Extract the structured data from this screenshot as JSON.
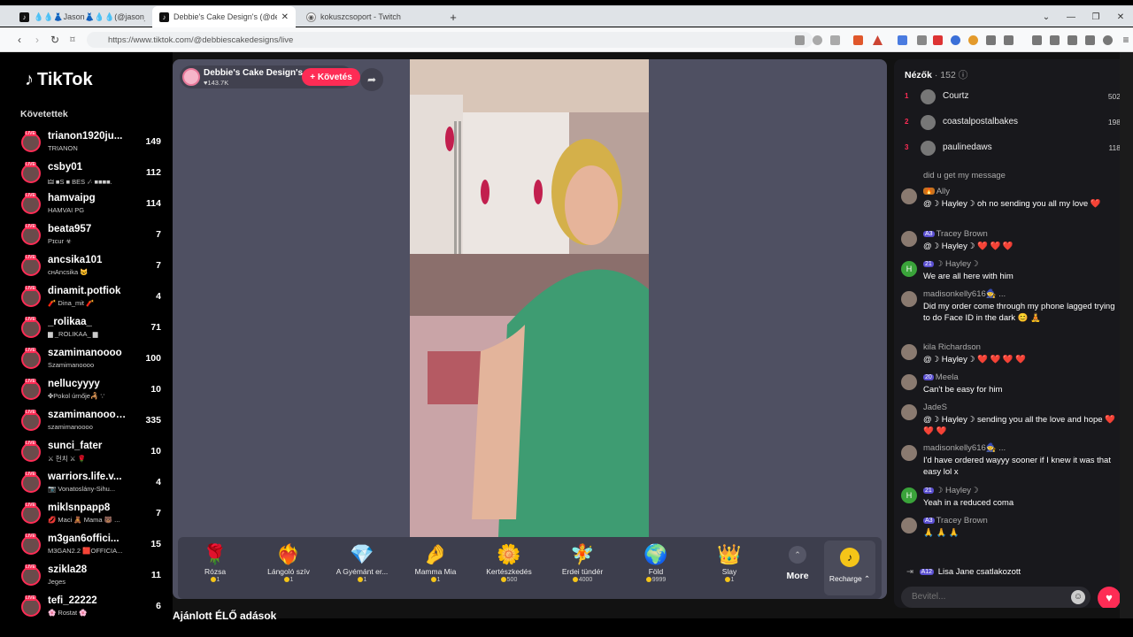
{
  "browser": {
    "tabs": [
      {
        "label": "💧💧👗Jason👗💧💧(@jason_sa",
        "fav": "♪"
      },
      {
        "label": "Debbie's Cake Design's (@de",
        "fav": "♪"
      },
      {
        "label": "kokuszcsoport - Twitch",
        "fav": "◉"
      }
    ],
    "url": "https://www.tiktok.com/@debbiescakedesigns/live",
    "new_tab": "+"
  },
  "sidebar": {
    "logo": "TikTok",
    "following_header": "Követettek",
    "items": [
      {
        "name": "trianon1920ju...",
        "sub": "TRIANON",
        "count": "149"
      },
      {
        "name": "csby01",
        "sub": "🜲 ■S ■ BES ·⁄· ■■■■.",
        "count": "112"
      },
      {
        "name": "hamvaipg",
        "sub": "HAMVAI PG",
        "count": "114"
      },
      {
        "name": "beata957",
        "sub": "Pɪcur ☣",
        "count": "7"
      },
      {
        "name": "ancsika101",
        "sub": "ᴄʜAncsika 😺",
        "count": "7"
      },
      {
        "name": "dinamit.potfiok",
        "sub": "🧨 Dina_mit 🧨",
        "count": "4"
      },
      {
        "name": "_rolikaa_",
        "sub": "▆ _ROLIKAA_ ▆",
        "count": "71"
      },
      {
        "name": "szamimanoooo",
        "sub": "Szamimanoooo",
        "count": "100"
      },
      {
        "name": "nellucyyyy",
        "sub": "✤Pokol úrnője🦂 ∵",
        "count": "10"
      },
      {
        "name": "szamimanoooooo",
        "sub": "szamimanoooo",
        "count": "335"
      },
      {
        "name": "sunci_fater",
        "sub": "⚔ 헌치 ⚔ 🌹",
        "count": "10"
      },
      {
        "name": "warriors.life.v...",
        "sub": "📷 Vonatoslány-Sihu...",
        "count": "4"
      },
      {
        "name": "miklsnpapp8",
        "sub": "💋 Maci 🧸 Mama 🐻 ...",
        "count": "7"
      },
      {
        "name": "m3gan6offici...",
        "sub": "M3GAN2.2 🟥OFFICIA...",
        "count": "15"
      },
      {
        "name": "szikla28",
        "sub": "Jeges",
        "count": "11"
      },
      {
        "name": "tefi_22222",
        "sub": "🌸 Rostat 🌸",
        "count": "6"
      }
    ]
  },
  "stage": {
    "host_name": "Debbie's Cake Design's",
    "host_likes": "♥143.7K",
    "follow_label": "+ Követés",
    "gifts": [
      {
        "icon": "🌹",
        "name": "Rózsa",
        "price": "1"
      },
      {
        "icon": "❤️‍🔥",
        "name": "Lángoló szív",
        "price": "1"
      },
      {
        "icon": "💎",
        "name": "A Gyémánt er...",
        "price": "1"
      },
      {
        "icon": "🤌",
        "name": "Mamma Mia",
        "price": "1"
      },
      {
        "icon": "🌼",
        "name": "Kertészkedés",
        "price": "500"
      },
      {
        "icon": "🧚",
        "name": "Erdei tündér",
        "price": "4000"
      },
      {
        "icon": "🌍",
        "name": "Föld",
        "price": "9999"
      },
      {
        "icon": "👑",
        "name": "Slay",
        "price": "1"
      }
    ],
    "more_label": "More",
    "recharge_label": "Recharge ⌃",
    "recommended_label": "Ajánlott ÉLŐ adások"
  },
  "chat": {
    "viewers_label": "Nézők",
    "viewers_count": "· 152",
    "top_viewers": [
      {
        "rank": "1",
        "name": "Courtz",
        "score": "502"
      },
      {
        "rank": "2",
        "name": "coastalpostalbakes",
        "score": "198"
      },
      {
        "rank": "3",
        "name": "paulinedaws",
        "score": "118"
      }
    ],
    "messages": [
      {
        "user": "did u get my message",
        "badge": "",
        "text": ""
      },
      {
        "user": "Ally",
        "badge": "🔥",
        "text": "@☽ Hayley☽  oh no sending you all my love ❤️"
      },
      {
        "user": "Tracey Brown",
        "badge": "A3",
        "text": "@☽ Hayley☽  ❤️ ❤️ ❤️"
      },
      {
        "user": "☽ Hayley☽",
        "badge": "21",
        "text": "We are all here with him"
      },
      {
        "user": "madisonkelly616🧙 ...",
        "badge": "",
        "text": "Did my order come through my phone lagged trying to do Face ID in the dark 😊 🧘"
      },
      {
        "user": "kila Richardson",
        "badge": "",
        "text": "@☽ Hayley☽  ❤️ ❤️ ❤️ ❤️"
      },
      {
        "user": "Meela",
        "badge": "20",
        "text": "Can't be easy for him"
      },
      {
        "user": "JadeS",
        "badge": "",
        "text": "@☽ Hayley☽  sending you all the love and hope ❤️ ❤️ ❤️"
      },
      {
        "user": "madisonkelly616🧙 ...",
        "badge": "",
        "text": "I'd have ordered wayyy sooner if I knew it was that easy lol x"
      },
      {
        "user": "☽ Hayley☽",
        "badge": "21",
        "text": "Yeah in a reduced coma"
      },
      {
        "user": "Tracey Brown",
        "badge": "A3",
        "text": "🙏 🙏 🙏"
      }
    ],
    "joined_badge": "A12",
    "joined_user": "Lisa Jane",
    "joined_text": "csatlakozott",
    "input_placeholder": "Bevitel..."
  }
}
